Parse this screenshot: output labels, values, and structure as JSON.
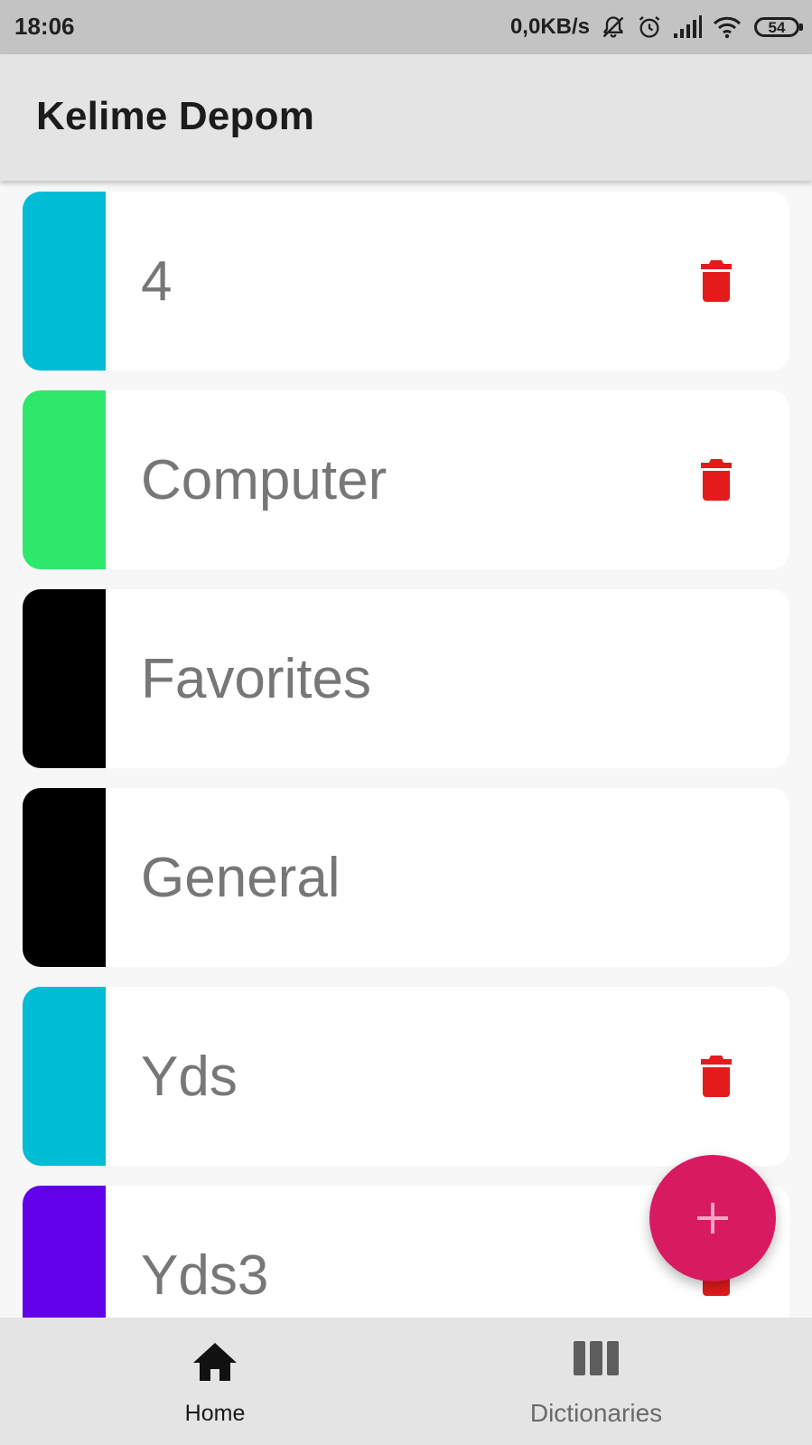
{
  "status_bar": {
    "time": "18:06",
    "network_speed": "0,0KB/s",
    "battery_level": "54",
    "icons": [
      "bell-off-icon",
      "alarm-icon",
      "signal-icon",
      "wifi-icon",
      "battery-icon"
    ]
  },
  "app_bar": {
    "title": "Kelime Depom"
  },
  "dictionaries": [
    {
      "name": "4",
      "color": "#00bcd4",
      "deletable": true
    },
    {
      "name": "Computer",
      "color": "#2ee86c",
      "deletable": true
    },
    {
      "name": "Favorites",
      "color": "#000000",
      "deletable": false
    },
    {
      "name": "General",
      "color": "#000000",
      "deletable": false
    },
    {
      "name": "Yds",
      "color": "#00bcd4",
      "deletable": true
    },
    {
      "name": "Yds3",
      "color": "#6200ea",
      "deletable": true
    }
  ],
  "fab": {
    "icon": "plus-icon",
    "color": "#d81b60"
  },
  "bottom_nav": {
    "items": [
      {
        "label": "Home",
        "icon": "home-icon",
        "active": true
      },
      {
        "label": "Dictionaries",
        "icon": "library-icon",
        "active": false
      }
    ]
  },
  "colors": {
    "delete_icon": "#e31b1b",
    "app_bar_bg": "#e4e4e4",
    "status_bar_bg": "#c3c3c3"
  }
}
